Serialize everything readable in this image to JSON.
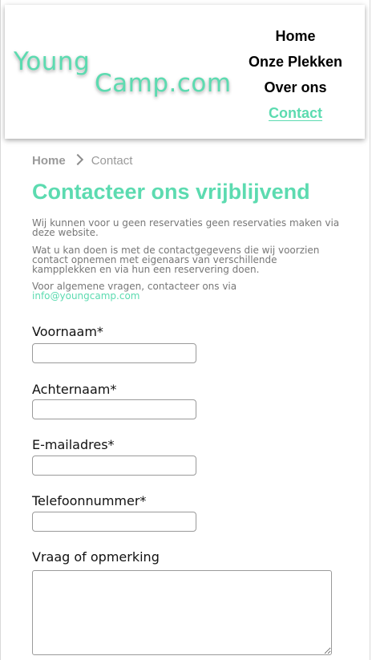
{
  "logo": {
    "line1": "Young",
    "line2": "Camp.com"
  },
  "nav": {
    "items": [
      {
        "label": "Home"
      },
      {
        "label": "Onze Plekken"
      },
      {
        "label": "Over ons"
      },
      {
        "label": "Contact"
      }
    ]
  },
  "breadcrumb": {
    "home": "Home",
    "current": "Contact"
  },
  "title": "Contacteer ons vrijblijvend",
  "intro": {
    "p1": "Wij kunnen voor u geen reservaties geen reservaties maken via deze website.",
    "p2": "Wat u kan doen is met de contactgegevens die wij voorzien contact opnemen met eigenaars van verschillende kampplekken en via hun een reservering doen.",
    "p3": "Voor algemene vragen, contacteer ons via",
    "email": "info@youngcamp.com"
  },
  "form": {
    "first_name": "Voornaam*",
    "last_name": "Achternaam*",
    "email": "E-mailadres*",
    "phone": "Telefoonnummer*",
    "question": "Vraag of opmerking"
  },
  "colors": {
    "accent": "#5cdbb0",
    "text": "#111111",
    "muted": "#777777"
  }
}
